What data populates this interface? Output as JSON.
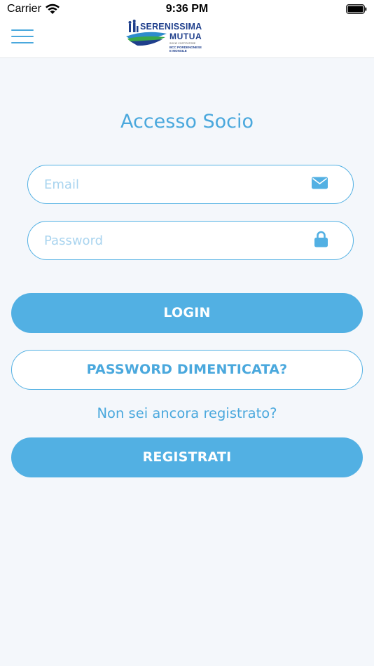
{
  "status_bar": {
    "carrier": "Carrier",
    "time": "9:36 PM"
  },
  "nav": {
    "logo": {
      "line1": "SERENISSIMA",
      "line2": "MUTUA",
      "small_text": "SOCIO COSTITUTORE",
      "bank_line1": "BCC PORDENONESE",
      "bank_line2": "E MONSILE"
    }
  },
  "login": {
    "title": "Accesso Socio",
    "email": {
      "value": "",
      "placeholder": "Email",
      "icon": "envelope-icon"
    },
    "password": {
      "value": "",
      "placeholder": "Password",
      "icon": "lock-icon"
    },
    "login_label": "LOGIN",
    "forgot_label": "PASSWORD DIMENTICATA?",
    "register_prompt": "Non sei ancora registrato?",
    "register_label": "REGISTRATI"
  },
  "colors": {
    "accent": "#52b0e3",
    "accent_text": "#4aa8dd",
    "placeholder": "#a9d4ef",
    "background": "#f4f7fb",
    "logo_blue": "#1f3f8c",
    "logo_green": "#3aa84a"
  }
}
